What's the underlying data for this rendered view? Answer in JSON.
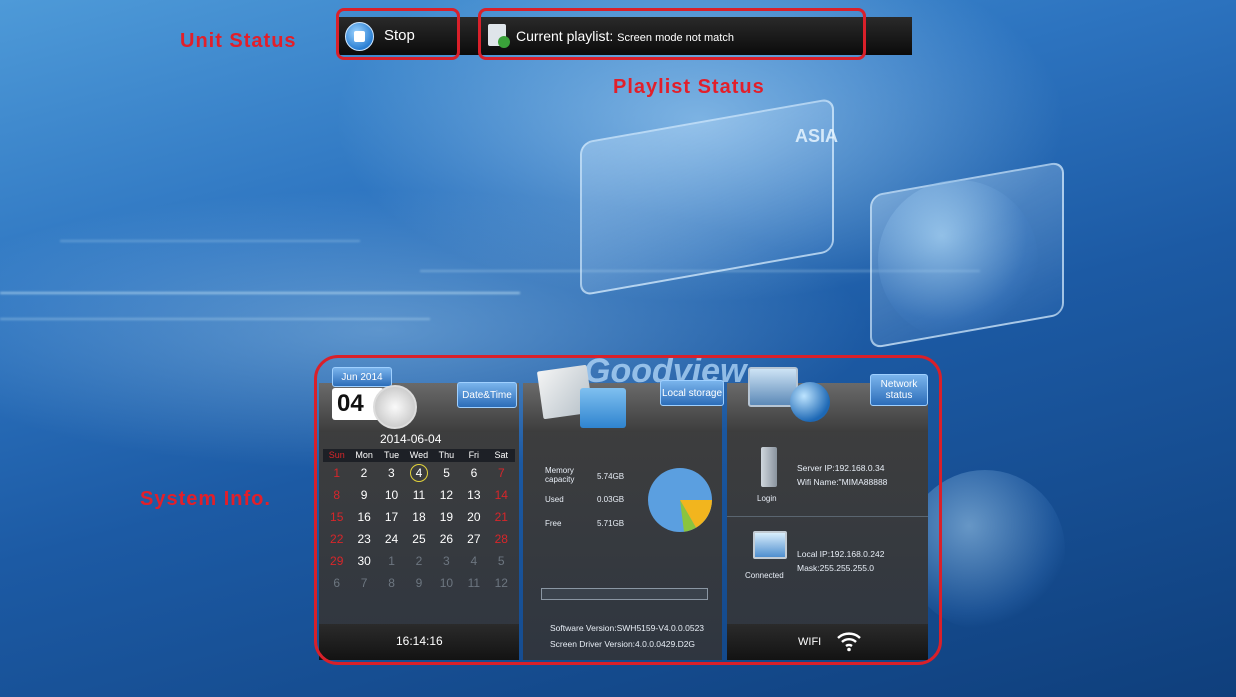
{
  "annotations": {
    "unit_status": "Unit  Status",
    "playlist_status": "Playlist Status",
    "system_info": "System  Info."
  },
  "topbar": {
    "state_label": "Stop",
    "playlist_label": "Current playlist:",
    "playlist_value": "Screen mode not match"
  },
  "background": {
    "watermark": "Goodview",
    "card_title": "ASIA"
  },
  "datetime": {
    "month_year": "Jun 2014",
    "day": "04",
    "button": "Date&Time",
    "date": "2014-06-04",
    "weekdays": [
      "Sun",
      "Mon",
      "Tue",
      "Wed",
      "Thu",
      "Fri",
      "Sat"
    ],
    "weeks": [
      [
        "1",
        "2",
        "3",
        "4",
        "5",
        "6",
        "7"
      ],
      [
        "8",
        "9",
        "10",
        "11",
        "12",
        "13",
        "14"
      ],
      [
        "15",
        "16",
        "17",
        "18",
        "19",
        "20",
        "21"
      ],
      [
        "22",
        "23",
        "24",
        "25",
        "26",
        "27",
        "28"
      ],
      [
        "29",
        "30",
        "1",
        "2",
        "3",
        "4",
        "5"
      ],
      [
        "6",
        "7",
        "8",
        "9",
        "10",
        "11",
        "12"
      ]
    ],
    "time": "16:14:16"
  },
  "storage": {
    "button": "Local storage",
    "memory_label": "Memory capacity",
    "memory_value": "5.74GB",
    "used_label": "Used",
    "used_value": "0.03GB",
    "free_label": "Free",
    "free_value": "5.71GB",
    "software_version": "Software Version:SWH5159-V4.0.0.0523",
    "driver_version": "Screen Driver Version:4.0.0.0429.D2G"
  },
  "network": {
    "button": "Network status",
    "login_label": "Login",
    "server_ip": "Server IP:192.168.0.34",
    "wifi_name": "Wifi Name:\"MIMA88888",
    "connected_label": "Connected",
    "local_ip": "Local IP:192.168.0.242",
    "mask": "Mask:255.255.255.0",
    "wifi_label": "WIFI"
  },
  "colors": {
    "annotation_red": "#e21f2a",
    "button_blue": "#2c6db9",
    "sunday_red": "#d8262a"
  }
}
